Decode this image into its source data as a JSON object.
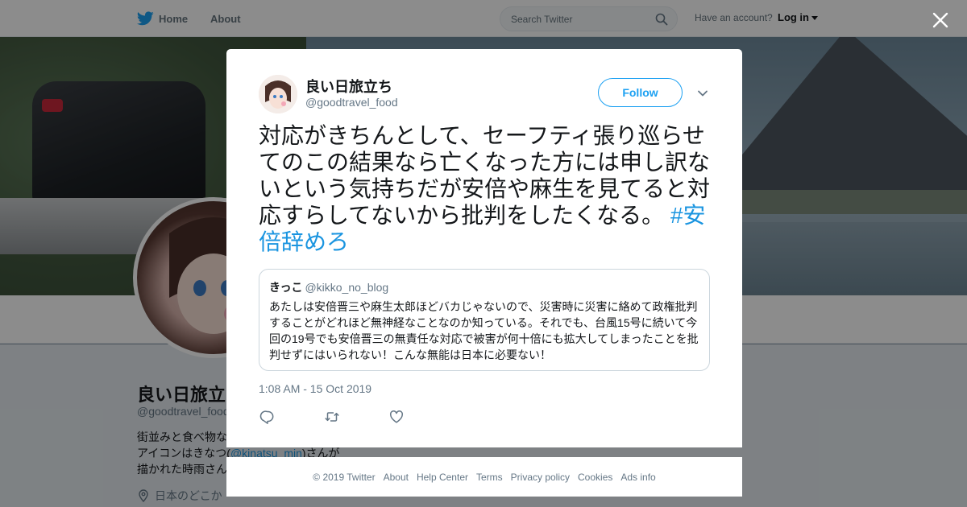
{
  "topbar": {
    "home_label": "Home",
    "about_label": "About",
    "search_placeholder": "Search Twitter",
    "have_account": "Have an account?",
    "login_label": "Log in"
  },
  "profile": {
    "name": "良い日旅立ち",
    "handle": "@goodtravel_food",
    "bio_line1": "街並みと食べ物な",
    "bio_line2_prefix": "アイコンはきなつ(",
    "bio_line2_link": "@kinatsu_min",
    "bio_line2_suffix": ")さんが",
    "bio_line3": "描かれた時雨さん",
    "location": "日本のどこか"
  },
  "tweet": {
    "author_name": "良い日旅立ち",
    "author_handle": "@goodtravel_food",
    "follow_label": "Follow",
    "text": "対応がきちんとして、セーフティ張り巡らせてのこの結果なら亡くなった方には申し訳ないという気持ちだが安倍や麻生を見てると対応すらしてないから批判をしたくなる。 ",
    "hashtag": "#安倍辞めろ",
    "timestamp": "1:08 AM - 15 Oct 2019",
    "quoted": {
      "name": "きっこ",
      "handle": "@kikko_no_blog",
      "text": "あたしは安倍晋三や麻生太郎ほどバカじゃないので、災害時に災害に絡めて政権批判することがどれほど無神経なことなのか知っている。それでも、台風15号に続いて今回の19号でも安倍晋三の無責任な対応で被害が何十倍にも拡大してしまったことを批判せずにはいられない！こんな無能は日本に必要ない！"
    }
  },
  "footer": {
    "items": [
      "© 2019 Twitter",
      "About",
      "Help Center",
      "Terms",
      "Privacy policy",
      "Cookies",
      "Ads info"
    ]
  },
  "colors": {
    "accent": "#1da1f2",
    "link": "#1b95e0",
    "secondary_text": "#657786"
  }
}
